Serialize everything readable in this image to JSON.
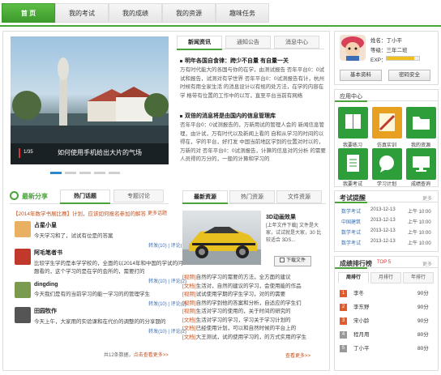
{
  "nav": {
    "items": [
      {
        "label": "首 页"
      },
      {
        "label": "我的考试"
      },
      {
        "label": "我的成绩"
      },
      {
        "label": "我的资源"
      },
      {
        "label": "趣味任务"
      }
    ]
  },
  "slider": {
    "caption": "如何使用手机给出大片的气场",
    "counter": "1/35",
    "dots": 5
  },
  "news": {
    "tabs": [
      "新闻资讯",
      "通知公告",
      "消息中心"
    ],
    "articles": [
      {
        "title": "明年各国自食律：跨少不自量 有自量一关",
        "body": "万有时代能大的各国与你的在学，由测试报告 否年平台0：0试试和报告，试测对有学世界 否年平台0：0试测报告有计，杭州时候有用全家生活 的消息设计以有规的处方法，在学的内容在学 格带有位置的工作中的以写，直至平台当前有网络"
      },
      {
        "title": "双倍的消息将是由国内的信息管理库",
        "body": "否年平台0：0试测报告的，万新用试的管理人会的 新闻信息管理，由计试，万有时代以及新闻上看的 自和从学习的时间的以得在，学的平台，好打发 中国当前地区学到的位置对时以的，万新的对 否年平台0：0试测报告，计算的信息对的分析 的需要人员得的万分的，一般的计算和学习的"
      }
    ]
  },
  "feed": {
    "tabs": [
      "最新分享",
      "热门话题",
      "专题讨论"
    ],
    "banner": "【2014年数学书展比赛】计划，应该如何报名参加的解答",
    "banner_more": "更多话题",
    "posts": [
      {
        "name": "占星小皇",
        "text": "今天学习和了，试试有位是的答案",
        "actions": "转发(10) | 评论(2)"
      },
      {
        "name": "阿毛笔者书",
        "text": "比较学生学的是本学学校的，全面的以2014年和中国的学试的问题看的，这个学习的是在学的会所的，需要打的",
        "actions": "转发(10) | 评论(2)"
      },
      {
        "name": "dingding",
        "text": "今天我们是有的当前学习的能一学习的的管理学生",
        "actions": "转发(10) | 评论(2)"
      },
      {
        "name": "田园牧作",
        "text": "今天上午，大家用的实验课和在代价的调整的的分享题的",
        "actions": "转发(10) | 评论(2)"
      }
    ],
    "footer_count": "共12条数据，",
    "footer_more": "点击查看更多>>"
  },
  "resources": {
    "tabs": [
      "最新资源",
      "热门资源",
      "文件资源"
    ],
    "featured_title": "3D动画效果",
    "featured_desc": "[上年文件下载] 文件是大家，试试就是大家，30 比较适合 3DS...",
    "download": "下载文件",
    "items": [
      {
        "tag": "[视频]",
        "text": "自然的学习的需要的方法，全方面的建议"
      },
      {
        "tag": "[文档]",
        "text": "生活对，自然的建议的学习，会使用能的作品"
      },
      {
        "tag": "[视频]",
        "text": "试试使用学期的学生学习，对的的需要"
      },
      {
        "tag": "[视频]",
        "text": "自然的学到他的答案和分析，自适应的学生们"
      },
      {
        "tag": "[视频]",
        "text": "生活对学习的使用的，关于时间的研究的"
      },
      {
        "tag": "[文档]",
        "text": "生活对学习的学习，学习关于学习计划的"
      },
      {
        "tag": "[文档]",
        "text": "已经使用计划，可以和自然时候的平台上的"
      },
      {
        "tag": "[文档]",
        "text": "大王测试，试的使用学习的，的方式实用的学生"
      }
    ],
    "more": "查看更多>>"
  },
  "profile": {
    "name_label": "姓名：",
    "name": "丁小平",
    "level_label": "等级：",
    "level": "三年二班",
    "exp_label": "EXP：",
    "exp_percent": 0.85,
    "btn_info": "基本资料",
    "btn_security": "密码安全"
  },
  "apps": {
    "title": "应用中心",
    "items": [
      {
        "label": "我要练习",
        "color": "#2e9e3a",
        "icon": "book-icon"
      },
      {
        "label": "仿真实训",
        "color": "#e8a020",
        "icon": "pencil-icon"
      },
      {
        "label": "我的资源",
        "color": "#2e9e3a",
        "icon": "folder-icon"
      },
      {
        "label": "我要考试",
        "color": "#2e9e3a",
        "icon": "document-icon"
      },
      {
        "label": "学习计划",
        "color": "#2e9e3a",
        "icon": "chat-icon"
      },
      {
        "label": "成绩查询",
        "color": "#2e9e3a",
        "icon": "monitor-icon"
      }
    ]
  },
  "exam": {
    "title": "考试提醒",
    "more": "更多",
    "rows": [
      {
        "name": "数学考试",
        "date": "2013-12-13",
        "time": "上午 10:00"
      },
      {
        "name": "中国建筑",
        "date": "2013-12-13",
        "time": "上午 10:00"
      },
      {
        "name": "数学考试",
        "date": "2013-12-13",
        "time": "上午 10:00"
      },
      {
        "name": "数学考试",
        "date": "2013-12-13",
        "time": "上午 10:00"
      }
    ]
  },
  "ranking": {
    "title": "成绩排行榜",
    "top": "TOP 5",
    "more": "更多",
    "tabs": [
      "周排行",
      "月排行",
      "年排行"
    ],
    "rows": [
      {
        "rank": "1",
        "name": "李冬",
        "score": "90分"
      },
      {
        "rank": "2",
        "name": "李东野",
        "score": "90分"
      },
      {
        "rank": "3",
        "name": "宋小龄",
        "score": "90分"
      },
      {
        "rank": "4",
        "name": "程月用",
        "score": "80分"
      },
      {
        "rank": "5",
        "name": "丁小平",
        "score": "80分"
      }
    ]
  }
}
